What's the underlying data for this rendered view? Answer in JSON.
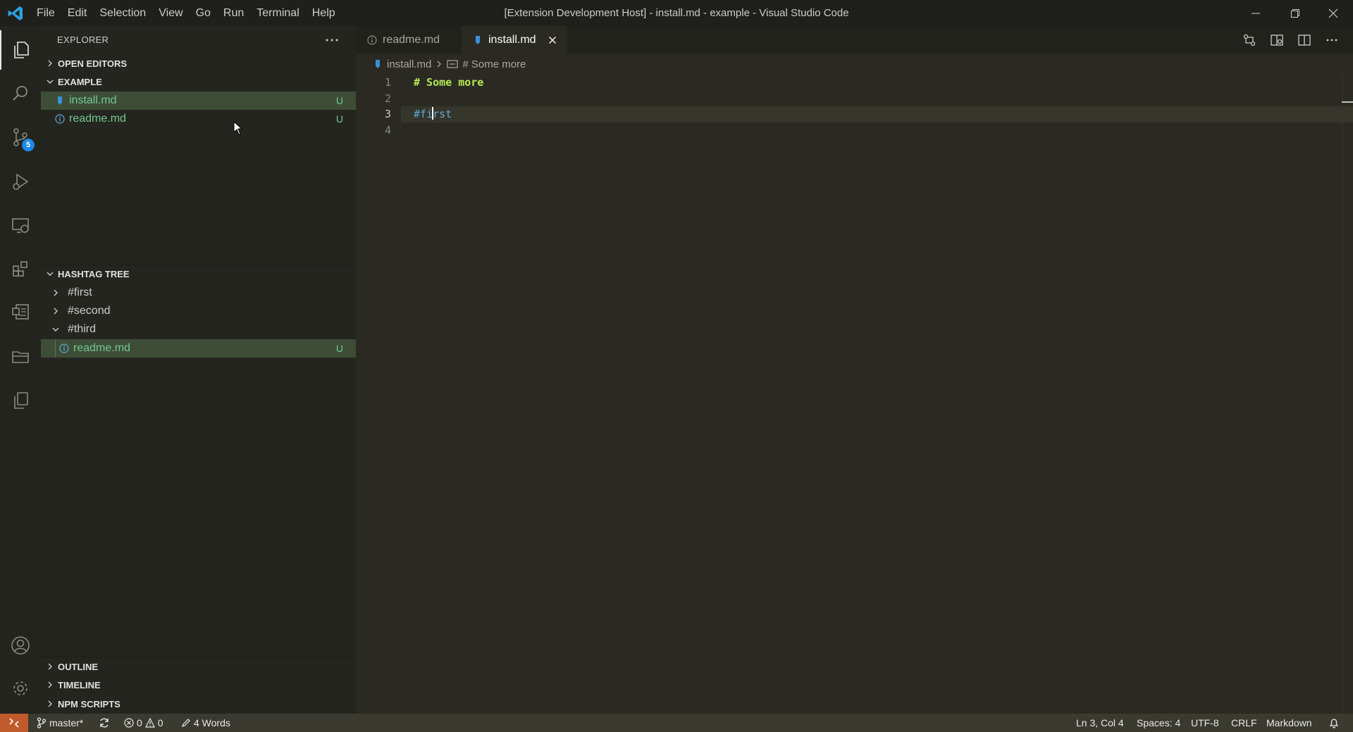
{
  "window": {
    "title": "[Extension Development Host] - install.md - example - Visual Studio Code",
    "menu": [
      "File",
      "Edit",
      "Selection",
      "View",
      "Go",
      "Run",
      "Terminal",
      "Help"
    ]
  },
  "activity_bar": {
    "items": [
      "explorer-icon",
      "search-icon",
      "source-control-icon",
      "run-debug-icon",
      "remote-explorer-icon",
      "extensions-icon",
      "hashtag-tree-icon",
      "folder-icon",
      "copy-icon"
    ],
    "source_control_badge": "5",
    "bottom": [
      "accounts-icon",
      "settings-gear-icon"
    ]
  },
  "sidebar": {
    "title": "EXPLORER",
    "open_editors": "OPEN EDITORS",
    "example": {
      "title": "EXAMPLE",
      "files": [
        {
          "name": "install.md",
          "status": "U"
        },
        {
          "name": "readme.md",
          "status": "U"
        }
      ]
    },
    "hashtag_tree": {
      "title": "HASHTAG TREE",
      "tags": [
        "#first",
        "#second",
        "#third"
      ],
      "child_file": {
        "name": "readme.md",
        "status": "U"
      }
    },
    "outline": "OUTLINE",
    "timeline": "TIMELINE",
    "npm_scripts": "NPM SCRIPTS"
  },
  "editor": {
    "tabs": [
      {
        "label": "readme.md"
      },
      {
        "label": "install.md"
      }
    ],
    "breadcrumb": {
      "file": "install.md",
      "symbol": "# Some more"
    },
    "lines": [
      {
        "number": "1",
        "text": "# Some more"
      },
      {
        "number": "2",
        "text": ""
      },
      {
        "number": "3",
        "text_before_cursor": "#fi",
        "text_after_cursor": "rst"
      },
      {
        "number": "4",
        "text": ""
      }
    ]
  },
  "status_bar": {
    "branch": "master*",
    "errors": "0",
    "warnings": "0",
    "words": "4 Words",
    "position": "Ln 3, Col 4",
    "spaces": "Spaces: 4",
    "encoding": "UTF-8",
    "eol": "CRLF",
    "language": "Markdown"
  },
  "colors": {
    "accent_green": "#73c991",
    "heading_green": "#b5e853",
    "hashtag_blue": "#5fa8d3",
    "remote_orange": "#c15a2b",
    "badge_blue": "#1e88e5"
  }
}
